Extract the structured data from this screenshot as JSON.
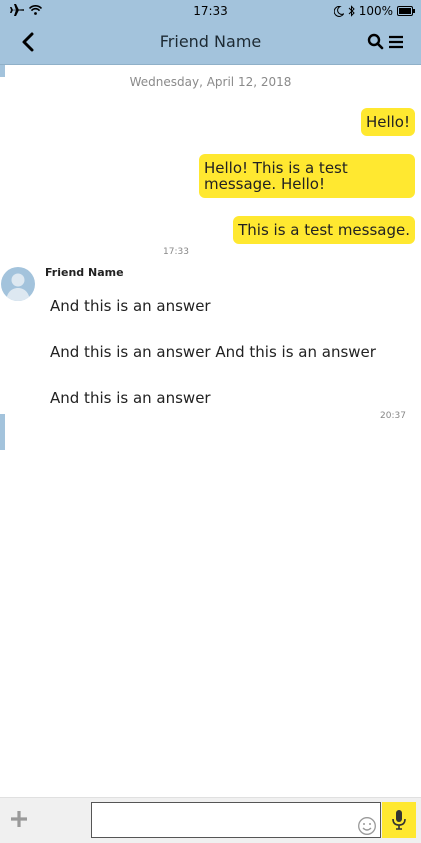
{
  "status_bar": {
    "time": "17:33",
    "battery": "100%",
    "icons": [
      "airplane-icon",
      "wifi-icon",
      "moon-icon",
      "bluetooth-icon",
      "battery-icon"
    ]
  },
  "header": {
    "title": "Friend Name",
    "icons": [
      "back-icon",
      "search-icon",
      "menu-icon"
    ]
  },
  "chat": {
    "date_divider": "Wednesday, April 12, 2018",
    "outgoing": [
      {
        "text": "Hello!"
      },
      {
        "text": "Hello! This is a test message. Hello!"
      },
      {
        "text": "This is a test message."
      }
    ],
    "outgoing_time": "17:33",
    "incoming": {
      "sender": "Friend Name",
      "messages": [
        {
          "text": "And this is an answer"
        },
        {
          "text": "And this is an answer And this is an answer"
        },
        {
          "text": "And this is an answer"
        }
      ],
      "time": "20:37"
    }
  },
  "composer": {
    "value": "",
    "placeholder": "",
    "icons": [
      "plus-icon",
      "emoji-icon",
      "microphone-icon"
    ]
  },
  "colors": {
    "header_bg": "#a3c3dc",
    "outgoing_bubble": "#ffe830",
    "mic_button": "#ffe830"
  }
}
